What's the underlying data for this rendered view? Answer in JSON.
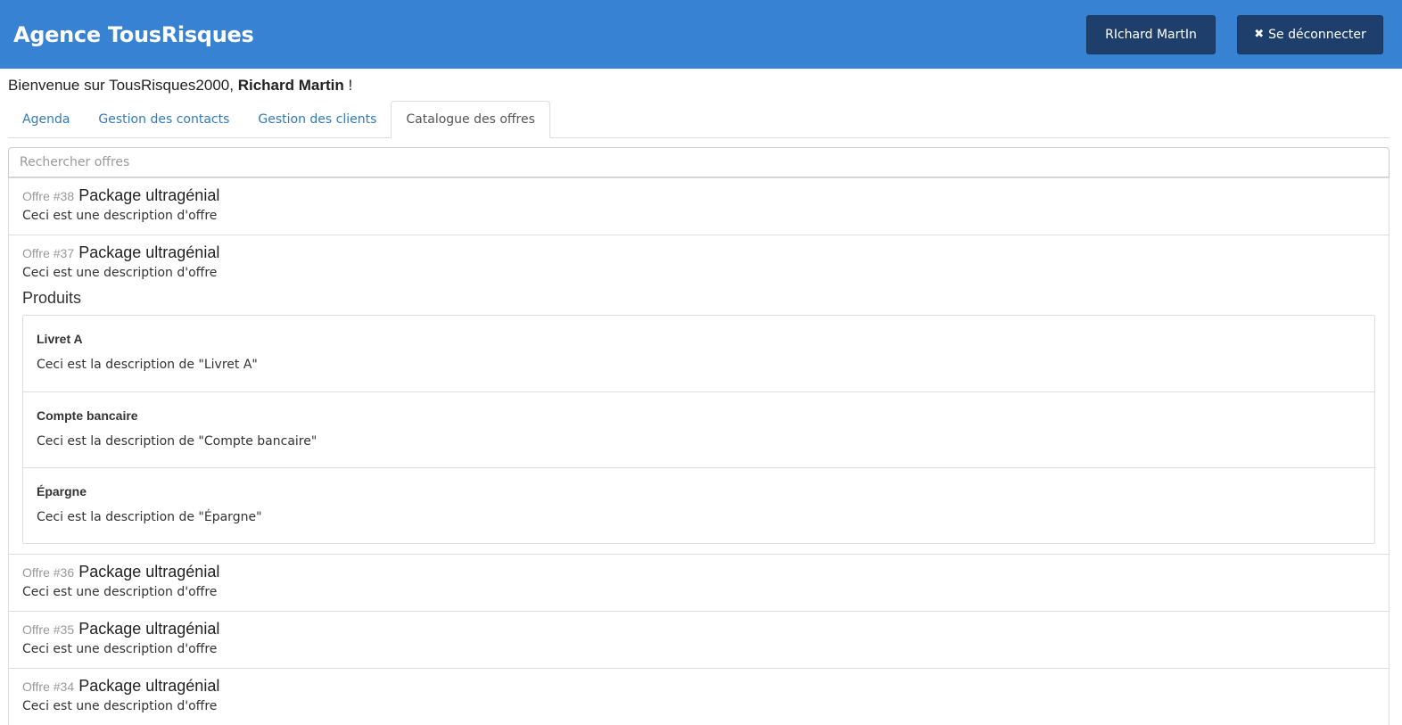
{
  "header": {
    "brand": "Agence TousRisques",
    "user_label": "RIchard MartIn",
    "logout_label": "Se déconnecter",
    "colors": {
      "bar": "#3882d3",
      "button": "#1e3f6b"
    }
  },
  "welcome": {
    "prefix": "Bienvenue sur TousRisques2000,",
    "name": "Richard Martin",
    "suffix": "!"
  },
  "tabs": [
    {
      "label": "Agenda",
      "active": false
    },
    {
      "label": "Gestion des contacts",
      "active": false
    },
    {
      "label": "Gestion des clients",
      "active": false
    },
    {
      "label": "Catalogue des offres",
      "active": true
    }
  ],
  "search": {
    "placeholder": "Rechercher offres",
    "value": ""
  },
  "offers": [
    {
      "number": "Offre #38",
      "title": "Package ultragénial",
      "description": "Ceci est une description d'offre"
    },
    {
      "number": "Offre #37",
      "title": "Package ultragénial",
      "description": "Ceci est une description d'offre",
      "products_title": "Produits",
      "products": [
        {
          "name": "Livret A",
          "description": "Ceci est la description de \"Livret A\""
        },
        {
          "name": "Compte bancaire",
          "description": "Ceci est la description de \"Compte bancaire\""
        },
        {
          "name": "Épargne",
          "description": "Ceci est la description de \"Épargne\""
        }
      ]
    },
    {
      "number": "Offre #36",
      "title": "Package ultragénial",
      "description": "Ceci est une description d'offre"
    },
    {
      "number": "Offre #35",
      "title": "Package ultragénial",
      "description": "Ceci est une description d'offre"
    },
    {
      "number": "Offre #34",
      "title": "Package ultragénial",
      "description": "Ceci est une description d'offre"
    }
  ]
}
